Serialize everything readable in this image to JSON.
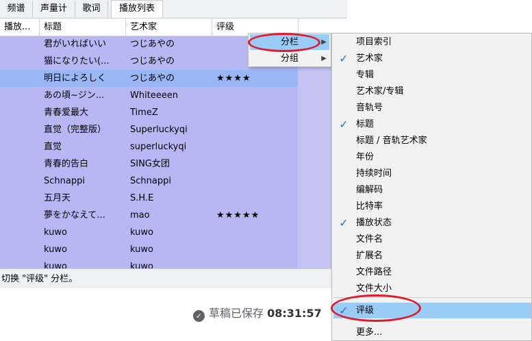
{
  "tabs": [
    "频谱",
    "声量计",
    "歌词",
    "播放列表"
  ],
  "columns": [
    "播放...",
    "标题",
    "艺术家",
    "评级"
  ],
  "rows": [
    {
      "title": "君がいればいい",
      "artist": "つじあやの",
      "rating": ""
    },
    {
      "title": "猫になりたい(...",
      "artist": "つじあやの",
      "rating": ""
    },
    {
      "title": "明日によろしく",
      "artist": "つじあやの",
      "rating": "★★★★"
    },
    {
      "title": "あの頃~ジン...",
      "artist": "Whiteeeen",
      "rating": ""
    },
    {
      "title": "青春爱最大",
      "artist": "TimeZ",
      "rating": ""
    },
    {
      "title": "直觉（完整版）",
      "artist": "Superluckyqi",
      "rating": ""
    },
    {
      "title": "直觉",
      "artist": "superluckyqi",
      "rating": ""
    },
    {
      "title": "青春的告白",
      "artist": "SING女团",
      "rating": ""
    },
    {
      "title": "Schnappi",
      "artist": "Schnappi",
      "rating": ""
    },
    {
      "title": "五月天",
      "artist": "S.H.E",
      "rating": ""
    },
    {
      "title": "夢をかなえて...",
      "artist": "mao",
      "rating": "★★★★★"
    },
    {
      "title": "kuwo",
      "artist": "kuwo",
      "rating": ""
    },
    {
      "title": "kuwo",
      "artist": "kuwo",
      "rating": ""
    },
    {
      "title": "kuwo",
      "artist": "kuwo",
      "rating": ""
    }
  ],
  "status_text": "切换 \"评级\" 分栏。",
  "saved": {
    "label": "草稿已保存",
    "time": "08:31:57"
  },
  "menu_main": [
    {
      "label": "分栏",
      "highlighted": true
    },
    {
      "label": "分组",
      "highlighted": false
    }
  ],
  "menu_columns": [
    {
      "label": "项目索引",
      "checked": false
    },
    {
      "label": "艺术家",
      "checked": true
    },
    {
      "label": "专辑",
      "checked": false
    },
    {
      "label": "艺术家/专辑",
      "checked": false
    },
    {
      "label": "音轨号",
      "checked": false
    },
    {
      "label": "标题",
      "checked": true
    },
    {
      "label": "标题 / 音轨艺术家",
      "checked": false
    },
    {
      "label": "年份",
      "checked": false
    },
    {
      "label": "持续时间",
      "checked": false
    },
    {
      "label": "编解码",
      "checked": false
    },
    {
      "label": "比特率",
      "checked": false
    },
    {
      "label": "播放状态",
      "checked": true
    },
    {
      "label": "文件名",
      "checked": false
    },
    {
      "label": "扩展名",
      "checked": false
    },
    {
      "label": "文件路径",
      "checked": false
    },
    {
      "label": "文件大小",
      "checked": false
    },
    {
      "label": "评级",
      "checked": true,
      "highlighted": true
    },
    {
      "label": "更多...",
      "checked": false
    }
  ],
  "colors": {
    "selection": "#9ab7f5",
    "rows": "#b7b7f3",
    "menu_highlight": "#99ccf7",
    "annotation": "#e01a2b"
  }
}
